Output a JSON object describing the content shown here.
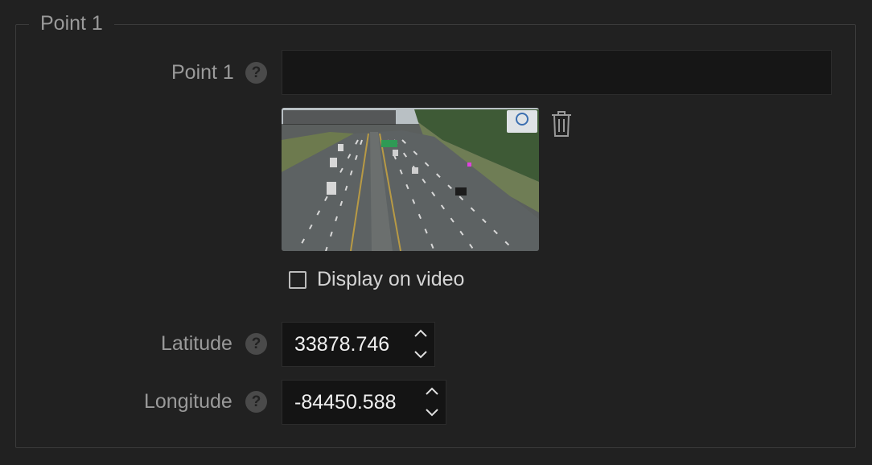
{
  "section": {
    "legend": "Point 1"
  },
  "point_field": {
    "label": "Point 1",
    "help": "?",
    "value": ""
  },
  "image_preview": {
    "icon": "trash-icon"
  },
  "display_on_video": {
    "label": "Display on video",
    "checked": false
  },
  "latitude": {
    "label": "Latitude",
    "help": "?",
    "value": "33878.746"
  },
  "longitude": {
    "label": "Longitude",
    "help": "?",
    "value": "-84450.588"
  }
}
